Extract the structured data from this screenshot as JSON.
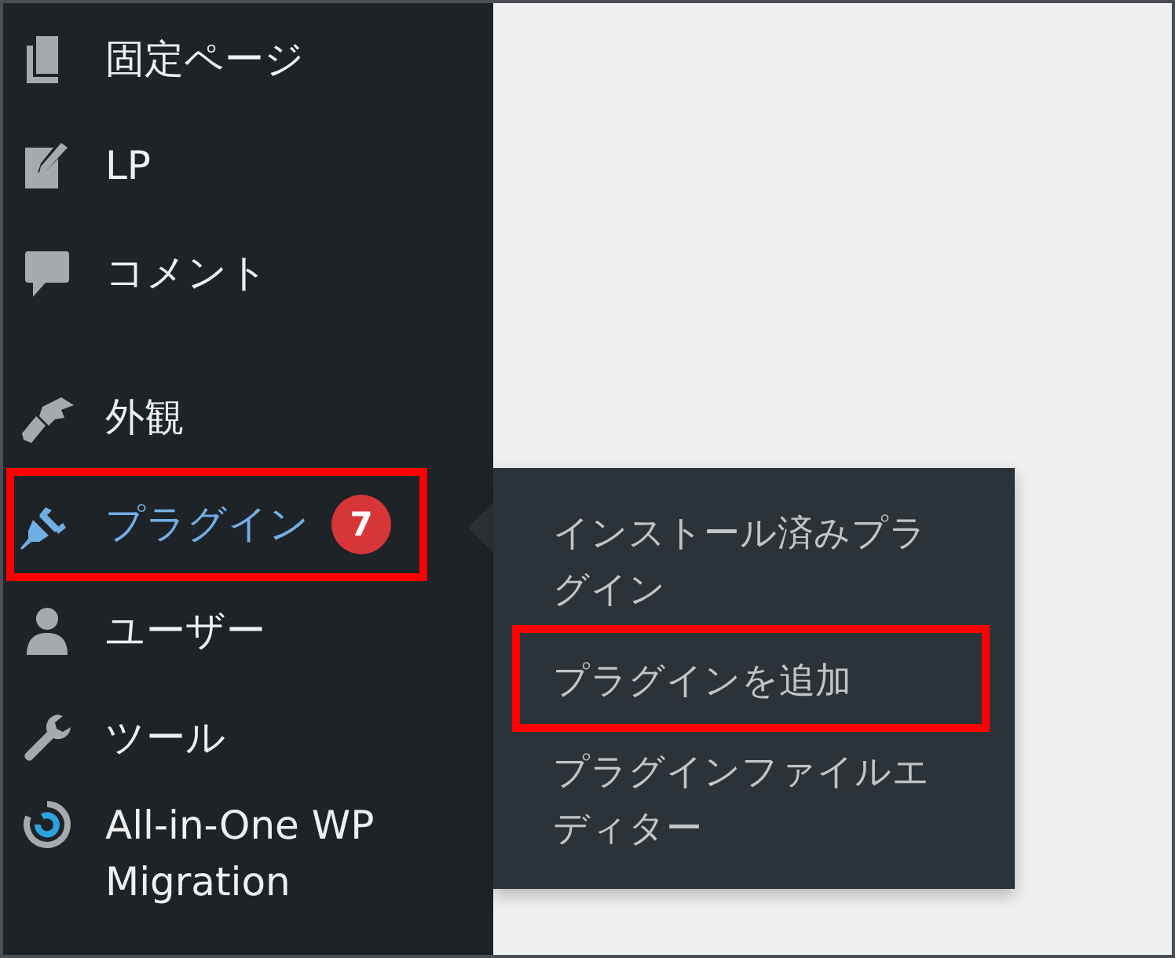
{
  "menu": [
    {
      "label": "固定ページ",
      "selected": false,
      "highlighted": false
    },
    {
      "label": "LP",
      "selected": false,
      "highlighted": false
    },
    {
      "label": "コメント",
      "selected": false,
      "highlighted": false
    },
    {
      "label": "外観",
      "selected": false,
      "highlighted": false,
      "group_start": true
    },
    {
      "label": "プラグイン",
      "selected": true,
      "highlighted": true,
      "badge": "7"
    },
    {
      "label": "ユーザー",
      "selected": false,
      "highlighted": false
    },
    {
      "label": "ツール",
      "selected": false,
      "highlighted": false
    },
    {
      "label": "All-in-One WP Migration",
      "selected": false,
      "highlighted": false
    }
  ],
  "submenu": {
    "items": [
      {
        "label": "インストール済みプラグイン",
        "highlighted": false
      },
      {
        "label": "プラグインを追加",
        "highlighted": true
      },
      {
        "label": "プラグインファイルエディター",
        "highlighted": false
      }
    ]
  }
}
